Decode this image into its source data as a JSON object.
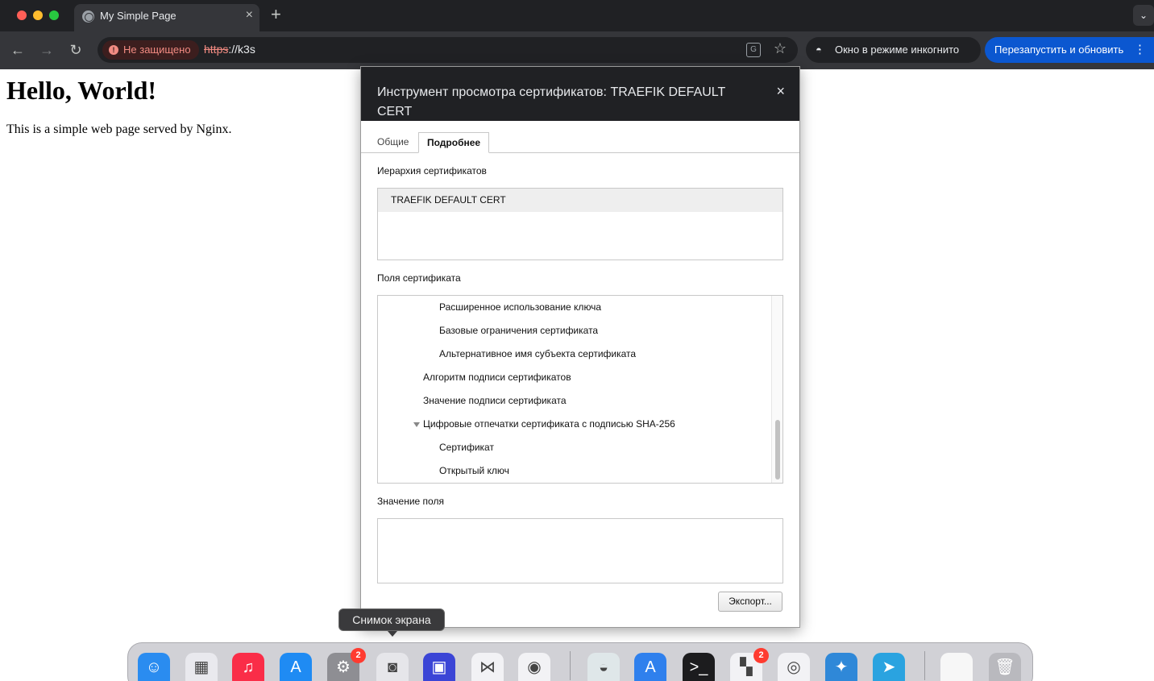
{
  "browser": {
    "tab": {
      "title": "My Simple Page"
    },
    "new_tab_label": "+",
    "tab_menu_label": "⌄",
    "nav": {
      "back": "←",
      "forward": "→",
      "reload": "↻"
    },
    "omnibox": {
      "security_label": "Не защищено",
      "url_scheme": "https",
      "url_rest": "://k3s"
    },
    "incognito_label": "Окно в режиме инкогнито",
    "restart_label": "Перезапустить и обновить",
    "colors": {
      "chrome_dark": "#202124",
      "chrome_toolbar": "#35363a",
      "accent": "#0b57d0",
      "warning": "#f28b82"
    }
  },
  "page": {
    "heading": "Hello, World!",
    "paragraph": "This is a simple web page served by Nginx."
  },
  "cert_dialog": {
    "title": "Инструмент просмотра сертификатов: TRAEFIK DEFAULT CERT",
    "close_label": "×",
    "tabs": [
      {
        "label": "Общие",
        "active": false
      },
      {
        "label": "Подробнее",
        "active": true
      }
    ],
    "hierarchy_label": "Иерархия сертификатов",
    "hierarchy_items": [
      "TRAEFIK DEFAULT CERT"
    ],
    "fields_label": "Поля сертификата",
    "fields": [
      {
        "label": "Расширенное использование ключа",
        "level": 3,
        "expandable": false
      },
      {
        "label": "Базовые ограничения сертификата",
        "level": 3,
        "expandable": false
      },
      {
        "label": "Альтернативное имя субъекта сертификата",
        "level": 3,
        "expandable": false
      },
      {
        "label": "Алгоритм подписи сертификатов",
        "level": 2,
        "expandable": false
      },
      {
        "label": "Значение подписи сертификата",
        "level": 2,
        "expandable": false
      },
      {
        "label": "Цифровые отпечатки сертификата с подписью SHA-256",
        "level": 2,
        "expandable": true
      },
      {
        "label": "Сертификат",
        "level": 3,
        "expandable": false
      },
      {
        "label": "Открытый ключ",
        "level": 3,
        "expandable": false
      }
    ],
    "value_label": "Значение поля",
    "field_value": "",
    "export_label": "Экспорт..."
  },
  "tooltip": {
    "text": "Снимок экрана"
  },
  "dock": {
    "apps": [
      {
        "name": "finder-icon",
        "color": "#2a8cf0",
        "glyph": "☺",
        "badge": ""
      },
      {
        "name": "launchpad-icon",
        "color": "#e9e9ee",
        "glyph": "▦",
        "badge": ""
      },
      {
        "name": "music-icon",
        "color": "#fa2d48",
        "glyph": "♫",
        "badge": ""
      },
      {
        "name": "app-store-icon",
        "color": "#1f8bf3",
        "glyph": "A",
        "badge": ""
      },
      {
        "name": "system-settings-icon",
        "color": "#8e8e93",
        "glyph": "⚙",
        "badge": "2"
      },
      {
        "name": "screenshot-icon",
        "color": "#e6e6ea",
        "glyph": "◙",
        "badge": ""
      },
      {
        "name": "ai-app-icon",
        "color": "#3b45d6",
        "glyph": "▣",
        "badge": ""
      },
      {
        "name": "vscode-icon",
        "color": "#f2f2f5",
        "glyph": "⋈",
        "badge": ""
      },
      {
        "name": "chrome-icon",
        "color": "#f2f2f5",
        "glyph": "◉",
        "badge": ""
      },
      {
        "name": "disk-app-icon",
        "color": "#dfe7e9",
        "glyph": "◒",
        "badge": ""
      },
      {
        "name": "ai-assistant-icon",
        "color": "#2f80ed",
        "glyph": "A",
        "badge": ""
      },
      {
        "name": "terminal-icon",
        "color": "#1c1c1e",
        "glyph": ">_",
        "badge": ""
      },
      {
        "name": "microsoft-icon",
        "color": "#f2f2f5",
        "glyph": "▚",
        "badge": "2"
      },
      {
        "name": "vpn-icon",
        "color": "#f2f2f5",
        "glyph": "◎",
        "badge": ""
      },
      {
        "name": "preview-icon",
        "color": "#2f88d8",
        "glyph": "✦",
        "badge": ""
      },
      {
        "name": "telegram-icon",
        "color": "#2aa3e0",
        "glyph": "➤",
        "badge": ""
      },
      {
        "name": "document-icon",
        "color": "#f7f7f7",
        "glyph": "",
        "badge": ""
      },
      {
        "name": "trash-icon",
        "color": "#b9b9be",
        "glyph": "🗑",
        "badge": ""
      }
    ]
  }
}
